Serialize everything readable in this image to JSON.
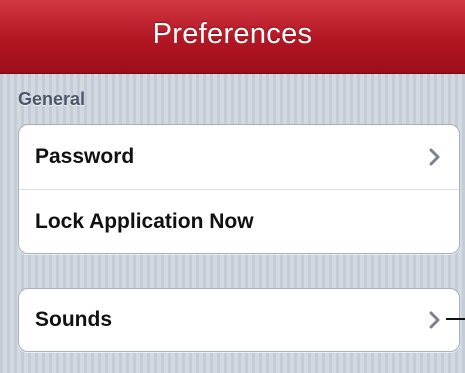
{
  "navbar": {
    "title": "Preferences"
  },
  "sections": [
    {
      "header": "General",
      "rows": [
        {
          "label": "Password",
          "icon": "chevron-right-icon"
        },
        {
          "label": "Lock Application Now"
        }
      ]
    },
    {
      "header": "",
      "rows": [
        {
          "label": "Sounds",
          "icon": "chevron-right-icon"
        }
      ]
    }
  ],
  "colors": {
    "navbar_red": "#b31623",
    "background": "#cbd2db",
    "section_header": "#4c566c",
    "chevron": "#7d828a"
  }
}
